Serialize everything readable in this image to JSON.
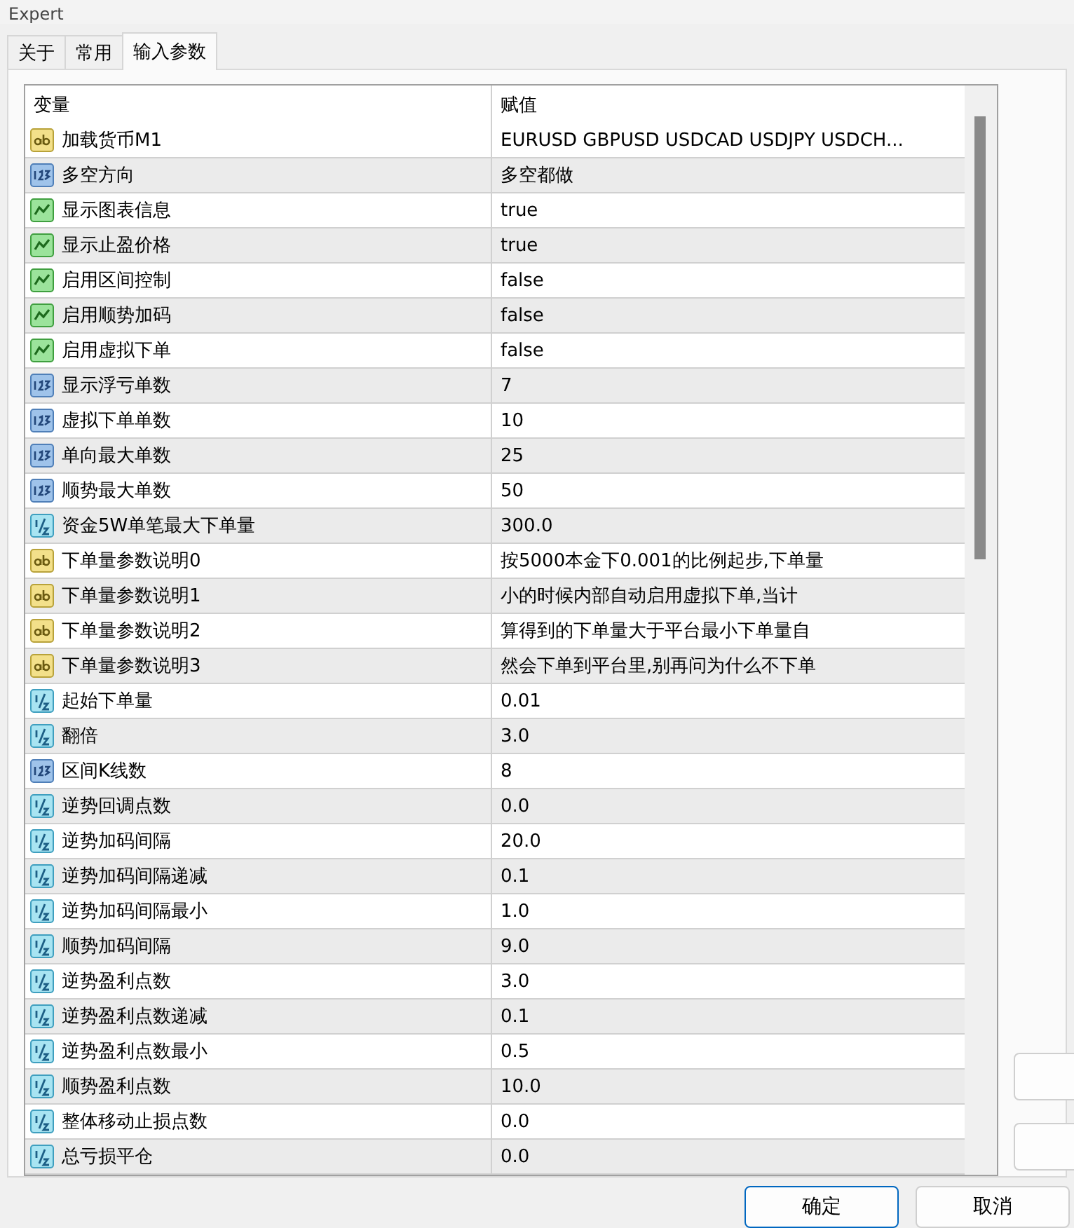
{
  "window": {
    "title": "Expert"
  },
  "tabs": [
    {
      "label": "关于",
      "selected": false
    },
    {
      "label": "常用",
      "selected": false
    },
    {
      "label": "输入参数",
      "selected": true
    }
  ],
  "table": {
    "columns": [
      "变量",
      "赋值"
    ],
    "rows": [
      {
        "kind": "string",
        "name": "加载货币M1",
        "value": "EURUSD GBPUSD USDCAD USDJPY USDCH..."
      },
      {
        "kind": "int",
        "name": "多空方向",
        "value": "多空都做"
      },
      {
        "kind": "bool",
        "name": "显示图表信息",
        "value": "true"
      },
      {
        "kind": "bool",
        "name": "显示止盈价格",
        "value": "true"
      },
      {
        "kind": "bool",
        "name": "启用区间控制",
        "value": "false"
      },
      {
        "kind": "bool",
        "name": "启用顺势加码",
        "value": "false"
      },
      {
        "kind": "bool",
        "name": "启用虚拟下单",
        "value": "false"
      },
      {
        "kind": "int",
        "name": "显示浮亏单数",
        "value": "7"
      },
      {
        "kind": "int",
        "name": "虚拟下单单数",
        "value": "10"
      },
      {
        "kind": "int",
        "name": "单向最大单数",
        "value": "25"
      },
      {
        "kind": "int",
        "name": "顺势最大单数",
        "value": "50"
      },
      {
        "kind": "double",
        "name": "资金5W单笔最大下单量",
        "value": "300.0"
      },
      {
        "kind": "string",
        "name": "下单量参数说明0",
        "value": "按5000本金下0.001的比例起步,下单量"
      },
      {
        "kind": "string",
        "name": "下单量参数说明1",
        "value": "小的时候内部自动启用虚拟下单,当计"
      },
      {
        "kind": "string",
        "name": "下单量参数说明2",
        "value": "算得到的下单量大于平台最小下单量自"
      },
      {
        "kind": "string",
        "name": "下单量参数说明3",
        "value": "然会下单到平台里,别再问为什么不下单"
      },
      {
        "kind": "double",
        "name": "起始下单量",
        "value": "0.01"
      },
      {
        "kind": "double",
        "name": "翻倍",
        "value": "3.0"
      },
      {
        "kind": "int",
        "name": "区间K线数",
        "value": "8"
      },
      {
        "kind": "double",
        "name": "逆势回调点数",
        "value": "0.0"
      },
      {
        "kind": "double",
        "name": "逆势加码间隔",
        "value": "20.0"
      },
      {
        "kind": "double",
        "name": "逆势加码间隔递减",
        "value": "0.1"
      },
      {
        "kind": "double",
        "name": "逆势加码间隔最小",
        "value": "1.0"
      },
      {
        "kind": "double",
        "name": "顺势加码间隔",
        "value": "9.0"
      },
      {
        "kind": "double",
        "name": "逆势盈利点数",
        "value": "3.0"
      },
      {
        "kind": "double",
        "name": "逆势盈利点数递减",
        "value": "0.1"
      },
      {
        "kind": "double",
        "name": "逆势盈利点数最小",
        "value": "0.5"
      },
      {
        "kind": "double",
        "name": "顺势盈利点数",
        "value": "10.0"
      },
      {
        "kind": "double",
        "name": "整体移动止损点数",
        "value": "0.0"
      },
      {
        "kind": "double",
        "name": "总亏损平仓",
        "value": "0.0"
      }
    ]
  },
  "buttons": [
    {
      "label": "确定",
      "selected": true
    },
    {
      "label": "取消",
      "selected": false
    }
  ]
}
